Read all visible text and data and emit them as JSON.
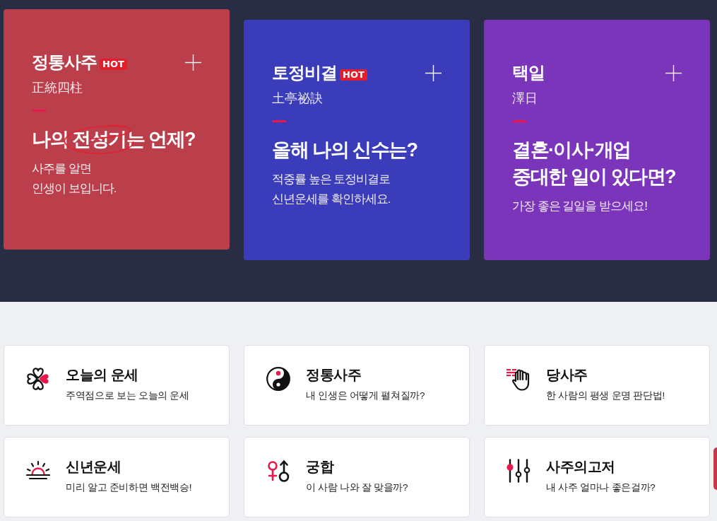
{
  "hero_cards": [
    {
      "title": "정통사주",
      "badge": "HOT",
      "subtitle": "正統四柱",
      "headline": [
        {
          "text": "나의 ",
          "circled": false
        },
        {
          "text": "전성기",
          "circled": true
        },
        {
          "text": "는 언제?",
          "circled": false
        }
      ],
      "description": "사주를 알면\n인생이 보입니다.",
      "color": "#bb3e4b"
    },
    {
      "title": "토정비결",
      "badge": "HOT",
      "subtitle": "土亭祕訣",
      "headline": [
        {
          "text": "올해 나의 신수는?",
          "circled": false
        }
      ],
      "description": "적중률 높은 토정비결로\n신년운세를 확인하세요.",
      "color": "#3b3cb9"
    },
    {
      "title": "택일",
      "subtitle": "澤日",
      "headline": [
        {
          "text": "결혼·이사·개업\n중대한 일이 있다면?",
          "circled": false
        }
      ],
      "description": "가장 좋은 길일을 받으세요!",
      "color": "#7a35bb"
    }
  ],
  "services": [
    {
      "title": "오늘의 운세",
      "description": "주역점으로 보는 오늘의 운세"
    },
    {
      "title": "정통사주",
      "description": "내 인생은 어떻게 펼쳐질까?"
    },
    {
      "title": "당사주",
      "description": "한 사람의 평생 운명 판단법!"
    },
    {
      "title": "신년운세",
      "description": "미리 알고 준비하면 백전백승!"
    },
    {
      "title": "궁합",
      "description": "이 사람 나와 잘 맞을까?"
    },
    {
      "title": "사주의고저",
      "description": "내 사주 얼마나 좋은걸까?"
    }
  ]
}
